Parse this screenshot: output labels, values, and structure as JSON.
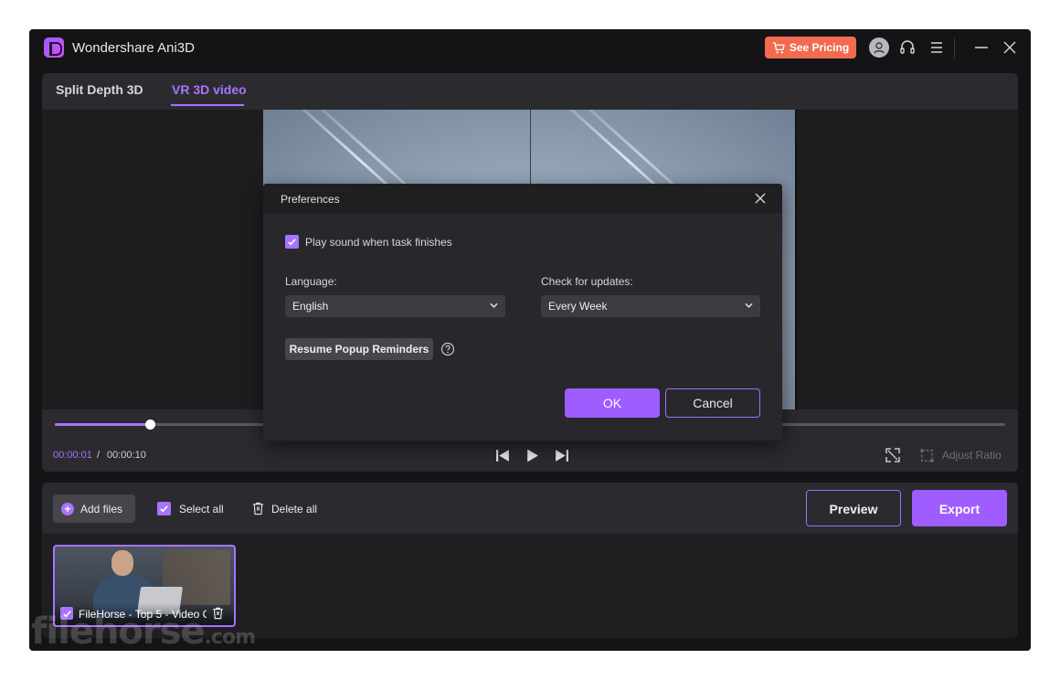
{
  "app": {
    "title": "Wondershare Ani3D",
    "pricing_label": "See Pricing"
  },
  "colors": {
    "accent": "#a873ff",
    "pricing": "#f26a4f",
    "window_bg": "#141416",
    "panel_bg": "#2b2b2f"
  },
  "tabs": [
    {
      "label": "Split Depth 3D",
      "active": false
    },
    {
      "label": "VR 3D video",
      "active": true
    }
  ],
  "player": {
    "current_time": "00:00:01",
    "separator": "/",
    "total_time": "00:00:10",
    "progress": 0.1,
    "adjust_ratio_label": "Adjust Ratio"
  },
  "dialog": {
    "title": "Preferences",
    "play_sound_label": "Play sound when task finishes",
    "play_sound_checked": true,
    "language_label": "Language:",
    "language_value": "English",
    "updates_label": "Check for updates:",
    "updates_value": "Every Week",
    "resume_label": "Resume Popup Reminders",
    "ok_label": "OK",
    "cancel_label": "Cancel"
  },
  "files": {
    "add_label": "Add files",
    "select_all_label": "Select all",
    "delete_all_label": "Delete all",
    "preview_label": "Preview",
    "export_label": "Export",
    "items": [
      {
        "name": "FileHorse - Top 5 - Video C",
        "checked": true
      }
    ]
  },
  "icons": [
    "app-logo-icon",
    "cart-icon",
    "user-icon",
    "headset-icon",
    "menu-icon",
    "minimize-icon",
    "close-icon",
    "skip-back-icon",
    "play-icon",
    "skip-forward-icon",
    "fullscreen-icon",
    "ratio-icon",
    "checkbox-icon",
    "chevron-down-icon",
    "help-icon",
    "plus-icon",
    "trash-icon"
  ],
  "watermark": {
    "text": "filehorse",
    "suffix": ".com"
  }
}
